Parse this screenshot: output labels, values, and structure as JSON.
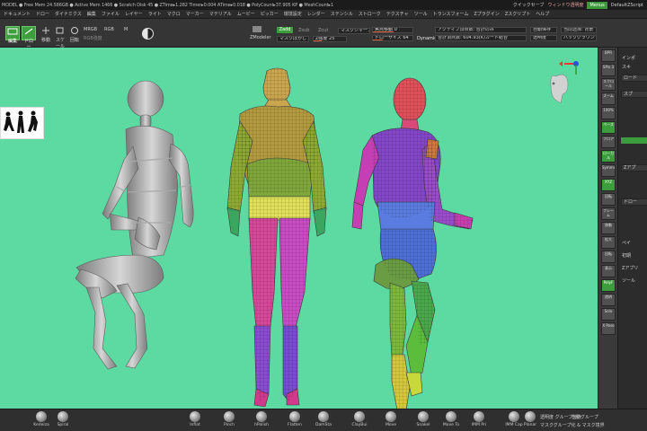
{
  "statusbar": {
    "text": "MODEL  ● Free Mem 24.586GB ● Active Mem 1466 ● Scratch Disk 45 ● ZTime▸1.282 Timer▸0.004 ATime▸0.018 ● PolyCount▸37.905 KP ● MeshCount▸1",
    "quicksave": "クイックセーブ",
    "window_transparency": "ウィンドウ透明度",
    "menus_button": "Menus",
    "default_script": "DefaultZScript"
  },
  "menubar": {
    "items": [
      "ドキュメント",
      "ドロー",
      "ダイナミクス",
      "編集",
      "ファイル",
      "レイヤー",
      "ライト",
      "マクロ",
      "マーカー",
      "マテリアル",
      "ムービー",
      "ピッカー",
      "環境設定",
      "レンダー",
      "ステンシル",
      "ストローク",
      "テクスチャ",
      "ツール",
      "トランスフォーム",
      "Zプラグイン",
      "Zスクリプト",
      "ヘルプ"
    ]
  },
  "toolbar": {
    "edit_label": "編集",
    "draw_label": "ドロー",
    "move_label": "移動",
    "scale_label": "スケール",
    "rotate_label": "回転",
    "mrgb": "MRGB",
    "rgb": "RGB",
    "m": "M",
    "rgb_intensity": "RGB強度",
    "zmodeler": "ZModeler",
    "zadd": "Zadd",
    "zsub": "Zsub",
    "zcut": "Zcut",
    "focal_shift_label": "焦点移動 0",
    "draw_size_label": "ドローサイズ 64",
    "dynamic": "Dynamic",
    "z_intensity_label": "Z強度 25",
    "smooth_mask": "マスクぼかし",
    "mask_sharpen": "マスクシャープ",
    "active_points": "アクティブ頂点数: 合計のみ",
    "total_points": "合計頂点数: 604.93(K)カード結合",
    "pointer_select": "当前选择: 背景",
    "autosave": "自動保存",
    "transparent": "透明度",
    "background_label": "バックグラウンド"
  },
  "viewport": {
    "background_color": "#5dd9a2"
  },
  "right_tools": [
    {
      "label": "BPR",
      "green": false
    },
    {
      "label": "SPix 3",
      "green": false
    },
    {
      "label": "スクロール",
      "green": false
    },
    {
      "label": "ズーム",
      "green": false
    },
    {
      "label": "100%",
      "green": false
    },
    {
      "label": "ペース",
      "green": true
    },
    {
      "label": "フロア",
      "green": false
    },
    {
      "label": "ローカル",
      "green": true
    },
    {
      "label": "Symmetry",
      "green": false
    },
    {
      "label": "XYZ",
      "green": true
    },
    {
      "label": "回転",
      "green": false
    },
    {
      "label": "フレーム",
      "green": false
    },
    {
      "label": "移動",
      "green": false
    },
    {
      "label": "拡大",
      "green": false
    },
    {
      "label": "回転",
      "green": false
    },
    {
      "label": "表示",
      "green": false
    },
    {
      "label": "PolyF",
      "green": true
    },
    {
      "label": "透明",
      "green": false
    },
    {
      "label": "Solo",
      "green": false
    },
    {
      "label": "X Pose",
      "green": false
    }
  ],
  "right_panel": {
    "items": [
      "インポ",
      "スキ",
      "ロード",
      "スプ",
      "Zアプ",
      "ペイ",
      "ドロー",
      "初期",
      "Zアプリ",
      "ツール"
    ]
  },
  "shelf": {
    "brushes": [
      "Kedeiza",
      "Spiral",
      "Inflat",
      "Pinch",
      "hPolish",
      "Flatten",
      "DamSta",
      "ClayBui",
      "Move",
      "Snakel",
      "Move To",
      "IMM Pri",
      "IMM Cap",
      "Planar"
    ],
    "text_line_1": "透明度 グループ分け",
    "text_line_2": "マスクグループ化 & マスク境界",
    "auto_groups": "自動グループ"
  }
}
